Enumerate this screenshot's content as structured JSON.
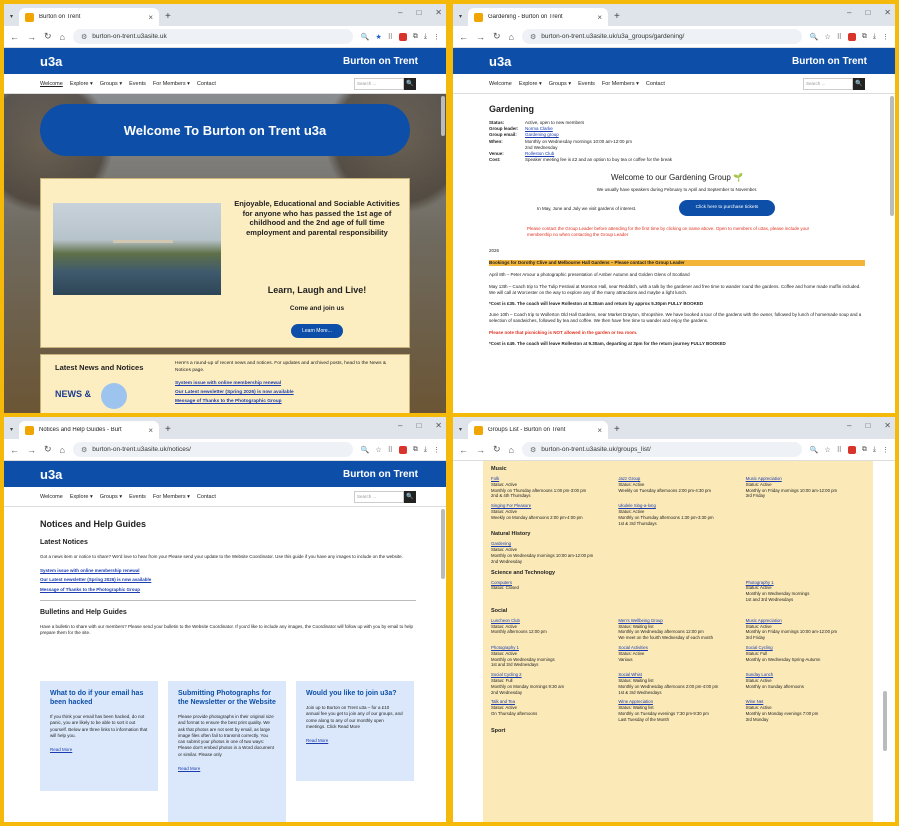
{
  "windows": [
    {
      "tab_title": "Burton on Trent",
      "url": "burton-on-trent.u3asite.uk"
    },
    {
      "tab_title": "Gardening - Burton on Trent",
      "url": "burton-on-trent.u3asite.uk/u3a_groups/gardening/"
    },
    {
      "tab_title": "Notices and Help Guides - Burt",
      "url": "burton-on-trent.u3asite.uk/notices/"
    },
    {
      "tab_title": "Groups List - Burton on Trent",
      "url": "burton-on-trent.u3asite.uk/groups_list/"
    }
  ],
  "site": {
    "logo": "u3a",
    "name": "Burton on Trent",
    "search_placeholder": "Search ...",
    "search_button": "🔍"
  },
  "nav": {
    "welcome": "Welcome",
    "explore": "Explore ▾",
    "groups": "Groups ▾",
    "events": "Events",
    "members": "For Members ▾",
    "contact": "Contact"
  },
  "home": {
    "welcome_title": "Welcome To Burton on Trent u3a",
    "card_text": "Enjoyable, Educational and Sociable Activities for anyone who has passed the 1st age of childhood and the 2nd age of full time employment and parental responsibility",
    "learn": "Learn, Laugh and Live!",
    "come": "Come and join us",
    "learn_more": "Learn More...",
    "news_title": "Latest News and Notices",
    "news_desc": "Here's a round-up of recent news and notices. For updates and archived posts, head to the News & Notices page.",
    "news_links": [
      "System issue with online membership renewal",
      "Our Latest newsletter (Spring 2026) is now available",
      "Message of Thanks to the Photographic Group"
    ],
    "news_art": "NEWS &"
  },
  "gardening": {
    "title": "Gardening",
    "info": [
      {
        "k": "Status:",
        "v": "Active, open to new members",
        "link": false
      },
      {
        "k": "Group leader:",
        "v": "Norma Clarke",
        "link": true
      },
      {
        "k": "Group email:",
        "v": "Gardening group",
        "link": true
      },
      {
        "k": "When:",
        "v": "Monthly on Wednesday mornings 10:00 am-12:00 pm",
        "link": false
      },
      {
        "k": "",
        "v": "2nd Wednesday",
        "link": false
      },
      {
        "k": "Venue:",
        "v": "Rolleston Club",
        "link": true
      },
      {
        "k": "Cost:",
        "v": "Speaker meeting fee is £2 and an option to buy tea or coffee for the break",
        "link": false
      }
    ],
    "welcome": "Welcome to our Gardening Group 🌱",
    "speakers": "We usually have speakers during February to April and September to November.",
    "visits": "In May, June and July we visit gardens of interest.",
    "tickets_btn": "Click here to purchase tickets",
    "contact_note": "Please contact the Group Leader before attending for the first time by clicking on name above. Open to members of u3as, please include your membership no when contacting the Group Leader",
    "year": "2026",
    "bookings": "Bookings for Dorothy Clive and Melbourne Hall Gardens – Please contact the Group Leader",
    "april": "April 8th – Peter Amour a photographic presentation of Amber Autumn and Golden Glens of Scotland",
    "may": "May 13th – Coach trip to The Tulip Festival at Moreton Hall, near Redditch, with a talk by the gardener and free time to wander round the gardens. Coffee and home made muffin included. We will call at Worcester on the way to explore any of the many attractions and maybe a light lunch.",
    "may_cost": "*Cost is £35. The coach will leave Rolleston at 8.30am and return by approx 5.30pm FULLY BOOKED",
    "june": "June 10th – Coach trip to Wollerton Old Hall Gardens, near Market Drayton, Shropshire. We have booked a tour of the gardens with the owner, followed by lunch of homemade soup and a selection of sandwiches, followed by tea and coffee. We then have free time to wander and enjoy the gardens.",
    "picnic": "Please note that picnicking is NOT allowed in the garden or tea room.",
    "june_cost": "*Cost is £49. The coach will leave Rolleston at 9.30am, departing at 3pm for the return journey FULLY BOOKED"
  },
  "notices": {
    "title": "Notices and Help Guides",
    "latest": "Latest Notices",
    "latest_desc": "Got a news item or notice to share? We'd love to hear from you! Please send your update to the Website Coordinator. Use this guide if you have any images to include on the website.",
    "links": [
      "System issue with online membership renewal",
      "Our Latest newsletter (Spring 2026) is now available",
      "Message of Thanks to the Photographic Group"
    ],
    "bulletins": "Bulletins and Help Guides",
    "bulletins_desc": "Have a bulletin to share with our members? Please send your bulletin to the Website Coordinator. If you'd like to include any images, the Coordinator will follow up with you by email to help prepare them for the site.",
    "boxes": [
      {
        "title": "What to do if your email has been hacked",
        "body": "If you think your email has been hacked, do not panic, you are likely to be able to sort it out yourself. Below are three links to information that will help you.",
        "more": "Read More"
      },
      {
        "title": "Submitting Photographs for the Newsletter or the Website",
        "body": "Please provide photographs in their original size and format to ensure the best print quality. We ask that photos are not sent by email, as large image files often fail to transmit correctly. You can submit your photos in one of two ways: Please don't embed photos in a Word document or similar. Please only",
        "more": "Read More"
      },
      {
        "title": "Would you like to join u3a?",
        "body": "Join up to Burton on Trent u3a – for a £10 annual fee you get to join any of our groups, and come along to any of our monthly open meetings. Click Read More",
        "more": "Read More"
      }
    ]
  },
  "groups_list": {
    "sections": [
      {
        "name": "Music",
        "items": [
          {
            "n": "Folk",
            "l": [
              "Status: Active",
              "Monthly on Thursday afternoons 1:00 pm-3:00 pm",
              "2nd & 4th Thursdays"
            ]
          },
          {
            "n": "Jazz Group",
            "l": [
              "Status: Active",
              "Weekly on Tuesday afternoons 2:00 pm-4:30 pm"
            ]
          },
          {
            "n": "Music Appreciation",
            "l": [
              "Status: Active",
              "Monthly on Friday mornings 10:00 am-12:00 pm",
              "3rd Friday"
            ]
          },
          {
            "n": "Singing For Pleasure",
            "l": [
              "Status: Active",
              "Weekly on Monday afternoons 2:00 pm-4:00 pm"
            ]
          },
          {
            "n": "Ukulele Sing-a-long",
            "l": [
              "Status: Active",
              "Monthly on Thursday afternoons 1:30 pm-3:30 pm",
              "1st & 3rd Thursdays"
            ]
          }
        ]
      },
      {
        "name": "Natural History",
        "items": [
          {
            "n": "Gardening",
            "l": [
              "Status: Active",
              "Monthly on Wednesday mornings 10:00 am-12:00 pm",
              "2nd Wednesday"
            ]
          }
        ]
      },
      {
        "name": "Science and Technology",
        "items": [
          {
            "n": "Computers",
            "l": [
              "Status: Closed"
            ]
          },
          {
            "n": "",
            "l": []
          },
          {
            "n": "Photography 1",
            "l": [
              "Status: Active",
              "Monthly on Wednesday mornings",
              "1st and 3rd Wednesdays"
            ]
          }
        ]
      },
      {
        "name": "Social",
        "items": [
          {
            "n": "Luncheon Club",
            "l": [
              "Status: Active",
              "Monthly afternoons 12:00 pm"
            ]
          },
          {
            "n": "Men's Wellbeing Group",
            "l": [
              "Status: Waiting list",
              "Monthly on Wednesday afternoons 12:00 pm",
              "We meet on the fourth Wednesday of each month"
            ]
          },
          {
            "n": "Music Appreciation",
            "l": [
              "Status: Active",
              "Monthly on Friday mornings 10:00 am-12:00 pm",
              "3rd Friday"
            ]
          },
          {
            "n": "Photography 1",
            "l": [
              "Status: Active",
              "Monthly on Wednesday mornings",
              "1st and 3rd Wednesdays"
            ]
          },
          {
            "n": "Social Activities",
            "l": [
              "Status: Active",
              "Various"
            ]
          },
          {
            "n": "Social Cycling",
            "l": [
              "Status: Full",
              "Monthly on Wednesday Spring-Autumn"
            ]
          },
          {
            "n": "Social Cycling 2",
            "l": [
              "Status: Full",
              "Monthly on Monday mornings 9:30 am",
              "2nd Wednesday"
            ]
          },
          {
            "n": "Social Whist",
            "l": [
              "Status: Waiting list",
              "Monthly on Wednesday afternoons 2:00 pm-4:00 pm",
              "1st & 3rd Wednesdays"
            ]
          },
          {
            "n": "Sunday Lunch",
            "l": [
              "Status: Active",
              "Monthly on Sunday afternoons"
            ]
          },
          {
            "n": "Talk and Tea",
            "l": [
              "Status: Active",
              "On Thursday afternoons"
            ]
          },
          {
            "n": "Wine Appreciation",
            "l": [
              "Status: Waiting list",
              "Monthly on Tuesday evenings 7:30 pm-9:30 pm",
              "Last Tuesday of the Month"
            ]
          },
          {
            "n": "Wine Net",
            "l": [
              "Status: Active",
              "Monthly on Monday evenings 7:00 pm",
              "3rd Monday"
            ]
          }
        ]
      },
      {
        "name": "Sport",
        "items": []
      }
    ]
  }
}
